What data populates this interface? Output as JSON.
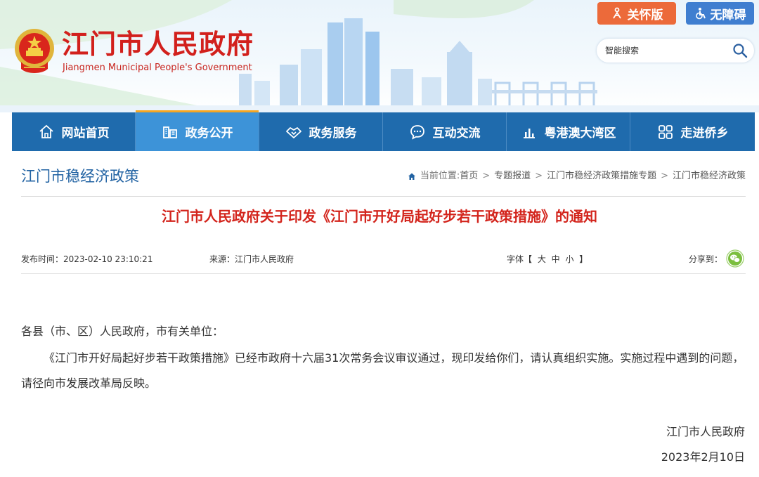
{
  "header": {
    "title_cn": "江门市人民政府",
    "title_en": "Jiangmen Municipal People's Government",
    "care_button": "关怀版",
    "access_button": "无障碍",
    "search_placeholder": "智能搜索"
  },
  "nav": {
    "items": [
      {
        "label": "网站首页",
        "icon": "home-icon"
      },
      {
        "label": "政务公开",
        "icon": "buildings-icon"
      },
      {
        "label": "政务服务",
        "icon": "handshake-icon"
      },
      {
        "label": "互动交流",
        "icon": "chat-icon"
      },
      {
        "label": "粤港澳大湾区",
        "icon": "bar-chart-icon"
      },
      {
        "label": "走进侨乡",
        "icon": "grid-icon"
      }
    ],
    "active_index": 1
  },
  "page": {
    "section_title": "江门市稳经济政策",
    "breadcrumb": {
      "prefix": "当前位置:",
      "items": [
        "首页",
        "专题报道",
        "江门市稳经济政策措施专题",
        "江门市稳经济政策"
      ],
      "separator": ">"
    }
  },
  "article": {
    "title": "江门市人民政府关于印发《江门市开好局起好步若干政策措施》的通知",
    "publish_time": "发布时间：2023-02-10 23:10:21",
    "source": "来源：江门市人民政府",
    "font_size_label": "字体【 大 中 小 】",
    "share_label": "分享到：",
    "salutation": "各县（市、区）人民政府，市有关单位：",
    "paragraph": "《江门市开好局起好步若干政策措施》已经市政府十六届31次常务会议审议通过，现印发给你们，请认真组织实施。实施过程中遇到的问题，请径向市发展改革局反映。",
    "signature_org": "江门市人民政府",
    "signature_date": "2023年2月10日"
  },
  "colors": {
    "brand_red": "#d3241c",
    "nav_blue": "#1f6bad",
    "nav_active": "#3d93d8",
    "care_orange": "#ec6a3a",
    "access_blue": "#3f7ed0",
    "wechat_green": "#7cbf3f"
  }
}
